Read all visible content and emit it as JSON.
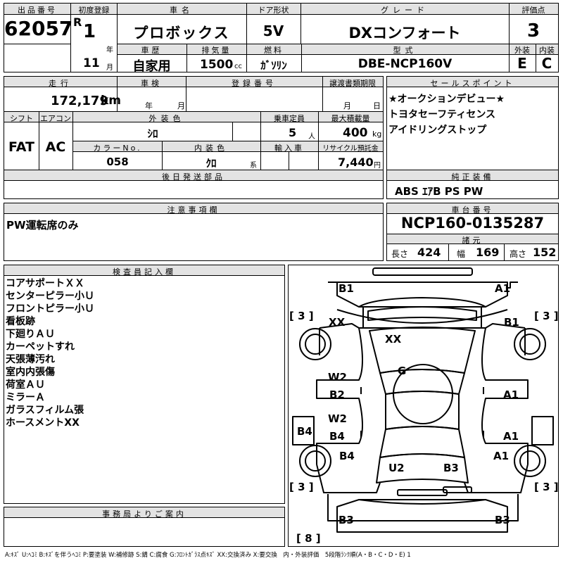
{
  "header": {
    "lot_no_label": "出品番号",
    "lot_no": "62057",
    "first_reg_label": "初度登録",
    "era": "R",
    "year": "1",
    "year_unit": "年",
    "month": "11",
    "month_unit": "月",
    "car_name_label": "車名",
    "car_name": "プロボックス",
    "door_label": "ドア形状",
    "door": "5V",
    "grade_label": "グレード",
    "grade": "DXコンフォート",
    "score_label": "評価点",
    "score": "3",
    "history_label": "車歴",
    "history": "自家用",
    "displacement_label": "排気量",
    "displacement": "1500",
    "displacement_unit": "cc",
    "fuel_label": "燃料",
    "fuel": "ｶﾞｿﾘﾝ",
    "model_label": "型式",
    "model": "DBE-NCP160V",
    "ext_label": "外装",
    "ext": "E",
    "int_label": "内装",
    "int": "C"
  },
  "row2": {
    "mileage_label": "走行",
    "mileage": "172,179",
    "mileage_unit": "km",
    "inspection_label": "車検",
    "insp_year": "年",
    "insp_month": "月",
    "reg_no_label": "登録番号",
    "transfer_label": "譲渡書類期限",
    "tr_month": "月",
    "tr_day": "日",
    "shift_label": "シフト",
    "shift": "FAT",
    "ac_label": "エアコン",
    "ac": "AC",
    "ext_color_label": "外装色",
    "ext_color": "ｼﾛ",
    "capacity_label": "乗車定員",
    "capacity": "5",
    "capacity_unit": "人",
    "max_load_label": "最大積載量",
    "max_load": "400",
    "max_load_unit": "kg",
    "color_no_label": "カラーNo.",
    "color_no": "058",
    "int_color_label": "内装色",
    "int_color": "ｸﾛ",
    "int_color_unit": "系",
    "import_label": "輸入車",
    "recycle_label": "リサイクル預託金",
    "recycle": "7,440",
    "recycle_unit": "円",
    "later_parts_label": "後日発送部品"
  },
  "sales": {
    "label": "セールスポイント",
    "items": [
      "★オークションデビュー★",
      "トヨタセーフティセンス",
      "アイドリングストップ"
    ]
  },
  "equipment": {
    "label": "純正装備",
    "value": "ABS ｴｱB PS PW"
  },
  "notes": {
    "label": "注意事項欄",
    "value": "PW運転席のみ"
  },
  "chassis": {
    "label": "車台番号",
    "value": "NCP160-0135287",
    "dims_label": "諸元",
    "length_label": "長さ",
    "length": "424",
    "width_label": "幅",
    "width": "169",
    "height_label": "高さ",
    "height": "152"
  },
  "inspector": {
    "label": "検査員記入欄",
    "items": [
      "コアサポートＸＸ",
      "センターピラー小Ｕ",
      "フロントピラー小Ｕ",
      "看板跡",
      "下廻りＡＵ",
      "カーペットすれ",
      "天張薄汚れ",
      "室内内張傷",
      "荷室ＡＵ",
      "ミラーＡ",
      "ガラスフィルム張",
      "ホースメントXX"
    ]
  },
  "office": {
    "label": "事務局よりご案内"
  },
  "diagram": {
    "marks": [
      "B1",
      "A1",
      "XX",
      "B1",
      "XX",
      "G",
      "W2",
      "B2",
      "A1",
      "W2",
      "B4",
      "A1",
      "B4",
      "B4",
      "A1",
      "U2",
      "B3",
      "B3",
      "B3"
    ],
    "tires": [
      "[ 3 ]",
      "[ 3 ]",
      "[ 3 ]",
      "[ 3 ]",
      "[ 8 ]"
    ]
  },
  "legend": "A:ｷｽﾞ U:ﾍｺﾐ B:ｷｽﾞを伴うﾍｺﾐ P:要塗装 W:補修跡 S:錆 C:腐食 G:ﾌﾛﾝﾄｶﾞﾗｽ点ｷｽﾞ XX:交換済み X:要交換　内・外装評価　5段階ﾗﾝｸ順(A・B・C・D・E) 1"
}
